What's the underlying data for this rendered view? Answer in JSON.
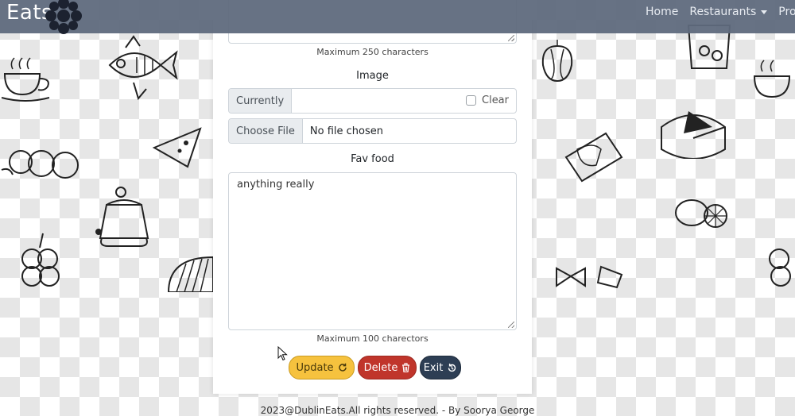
{
  "navbar": {
    "brand": "Eats",
    "links": [
      {
        "label": "Home"
      },
      {
        "label": "Restaurants"
      },
      {
        "label": "Profile"
      }
    ]
  },
  "form": {
    "bio_help": "Maximum 250 characters",
    "image": {
      "label": "Image",
      "currently_label": "Currently",
      "clear_label": "Clear",
      "choose_file_label": "Choose File",
      "no_file_text": "No file chosen"
    },
    "fav_food": {
      "label": "Fav food",
      "value": "anything really",
      "help": "Maximum 100 charectors"
    },
    "buttons": {
      "update": "Update",
      "delete": "Delete",
      "exit": "Exit"
    }
  },
  "footer": "2023@DublinEats.All rights reserved. - By Soorya George",
  "colors": {
    "navbar": "#5f6a7d",
    "update": "#f6c23e",
    "delete": "#c0352b",
    "exit": "#2d3e54"
  }
}
